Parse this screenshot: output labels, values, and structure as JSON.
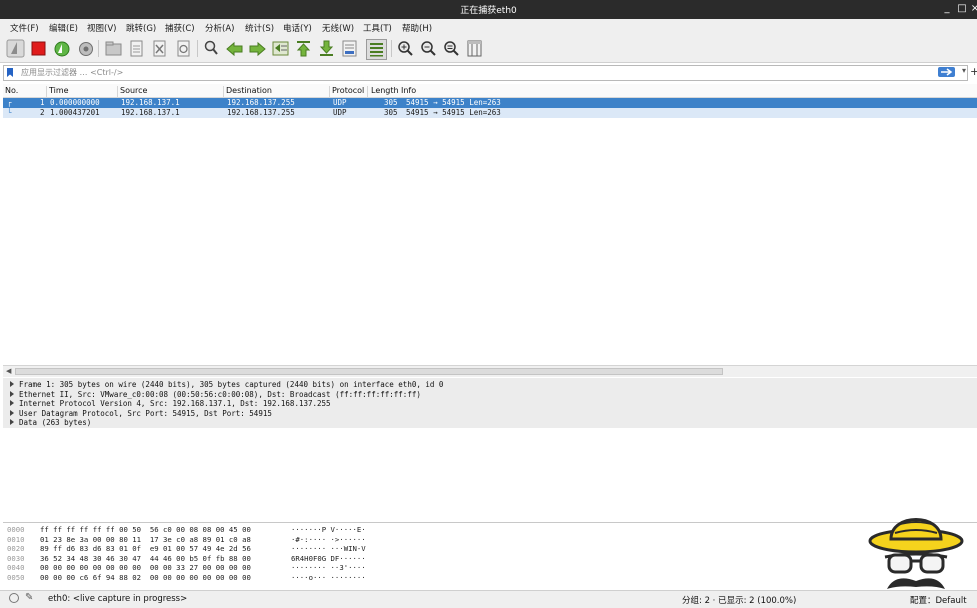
{
  "window": {
    "title": "正在捕获eth0",
    "controls": [
      "_",
      "□",
      "×"
    ]
  },
  "menu": [
    "文件(F)",
    "编辑(E)",
    "视图(V)",
    "跳转(G)",
    "捕获(C)",
    "分析(A)",
    "统计(S)",
    "电话(Y)",
    "无线(W)",
    "工具(T)",
    "帮助(H)"
  ],
  "toolbar": {
    "icons": [
      "shark-fin-start-icon",
      "stop-capture-icon",
      "restart-capture-icon",
      "capture-options-icon",
      "open-file-icon",
      "save-file-icon",
      "close-file-icon",
      "reload-file-icon",
      "find-packet-icon",
      "go-back-icon",
      "go-forward-icon",
      "go-to-packet-icon",
      "go-first-icon",
      "go-last-icon",
      "auto-scroll-icon",
      "colorize-icon",
      "zoom-in-icon",
      "zoom-out-icon",
      "zoom-normal-icon",
      "resize-columns-icon"
    ]
  },
  "filter": {
    "placeholder": "应用显示过滤器 … <Ctrl-/>"
  },
  "packet_list": {
    "columns": [
      "No.",
      "Time",
      "Source",
      "Destination",
      "Protocol",
      "Length",
      "Info"
    ],
    "rows": [
      {
        "no": "1",
        "time": "0.000000000",
        "source": "192.168.137.1",
        "destination": "192.168.137.255",
        "protocol": "UDP",
        "length": "305",
        "info": "54915 → 54915 Len=263"
      },
      {
        "no": "2",
        "time": "1.000437201",
        "source": "192.168.137.1",
        "destination": "192.168.137.255",
        "protocol": "UDP",
        "length": "305",
        "info": "54915 → 54915 Len=263"
      }
    ]
  },
  "details": [
    "Frame 1: 305 bytes on wire (2440 bits), 305 bytes captured (2440 bits) on interface eth0, id 0",
    "Ethernet II, Src: VMware_c0:00:08 (00:50:56:c0:00:08), Dst: Broadcast (ff:ff:ff:ff:ff:ff)",
    "Internet Protocol Version 4, Src: 192.168.137.1, Dst: 192.168.137.255",
    "User Datagram Protocol, Src Port: 54915, Dst Port: 54915",
    "Data (263 bytes)"
  ],
  "bytes": [
    {
      "offset": "0000",
      "hex": "ff ff ff ff ff ff 00 50  56 c0 00 08 08 00 45 00",
      "ascii": "·······P V·····E·"
    },
    {
      "offset": "0010",
      "hex": "01 23 8e 3a 00 00 80 11  17 3e c0 a8 89 01 c0 a8",
      "ascii": "·#·:···· ·>······"
    },
    {
      "offset": "0020",
      "hex": "89 ff d6 83 d6 83 01 0f  e9 01 00 57 49 4e 2d 56",
      "ascii": "········ ···WIN-V"
    },
    {
      "offset": "0030",
      "hex": "36 52 34 48 30 46 30 47  44 46 00 b5 0f fb 88 00",
      "ascii": "6R4H0F0G DF······"
    },
    {
      "offset": "0040",
      "hex": "00 00 00 00 00 00 00 00  00 00 33 27 00 00 00 00",
      "ascii": "········ ··3'····"
    },
    {
      "offset": "0050",
      "hex": "00 00 00 c6 6f 94 88 02  00 00 00 00 00 00 00 00",
      "ascii": "····o··· ········"
    }
  ],
  "status": {
    "interface": "eth0: <live capture in progress>",
    "packets": "分组: 2 · 已显示: 2 (100.0%)",
    "profile": "配置：Default"
  },
  "colors": {
    "selected_row": "#3d82c9",
    "alt_row": "#dbe8f7",
    "titlebar": "#2b2b2b",
    "hat": "#f5d31d"
  }
}
